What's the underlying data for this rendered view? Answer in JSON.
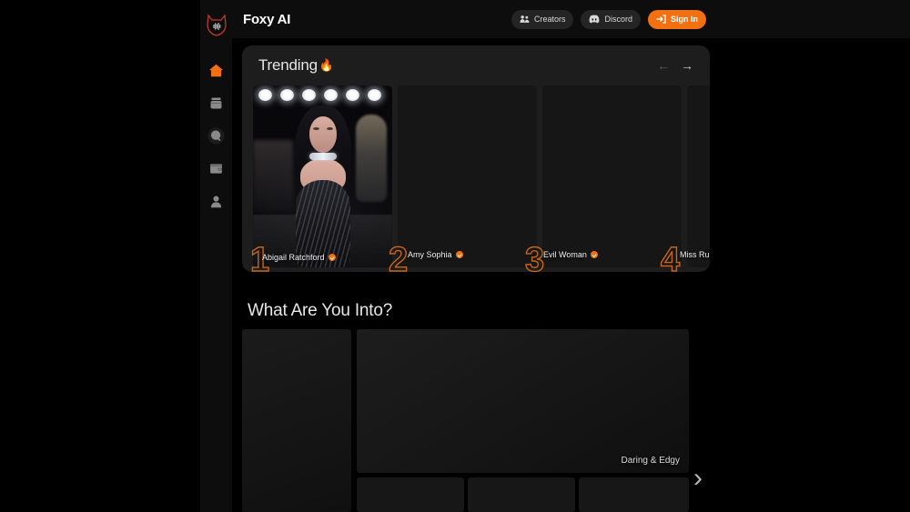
{
  "brand": {
    "title": "Foxy AI",
    "logo_icon": "fox-head-icon",
    "accent": "#f2700f"
  },
  "header": {
    "buttons": [
      {
        "label": "Creators",
        "icon": "users-icon",
        "style": "secondary"
      },
      {
        "label": "Discord",
        "icon": "discord-icon",
        "style": "secondary"
      },
      {
        "label": "Sign In",
        "icon": "login-arrow-icon",
        "style": "primary"
      }
    ]
  },
  "sidebar": {
    "items": [
      {
        "icon": "home-icon",
        "active": true
      },
      {
        "icon": "briefcase-icon",
        "active": false
      },
      {
        "icon": "search-icon",
        "active": false
      },
      {
        "icon": "wallet-icon",
        "active": false
      },
      {
        "icon": "user-icon",
        "active": false
      }
    ]
  },
  "trending": {
    "title": "Trending",
    "flame": "🔥",
    "prev_arrow": "←",
    "next_arrow": "→",
    "prev_enabled": false,
    "next_enabled": true,
    "cards": [
      {
        "rank": "1",
        "name": "Abigail Ratchford",
        "verified": true,
        "loaded": true
      },
      {
        "rank": "2",
        "name": "Amy Sophia",
        "verified": true,
        "loaded": false
      },
      {
        "rank": "3",
        "name": "Evil Woman",
        "verified": true,
        "loaded": false
      },
      {
        "rank": "4",
        "name": "Miss Ruby",
        "verified": true,
        "loaded": false
      }
    ]
  },
  "categories": {
    "title": "What Are You Into?",
    "featured_label": "Daring & Edgy",
    "next_arrow": "›"
  }
}
